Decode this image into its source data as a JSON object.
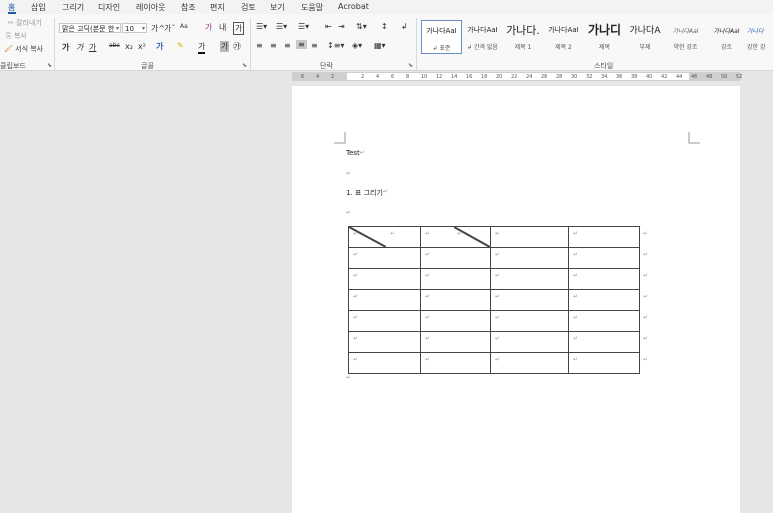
{
  "menu": [
    "홈",
    "삽입",
    "그리기",
    "디자인",
    "레이아웃",
    "참조",
    "편지",
    "검토",
    "보기",
    "도움말",
    "Acrobat"
  ],
  "clipboard": {
    "cut": "잘라내기",
    "copy": "복사",
    "format_painter": "서식 복사",
    "label": "클립보드"
  },
  "font": {
    "name": "맑은 고딕(본문 한",
    "size": "10",
    "grow": "가^",
    "shrink": "가ˇ",
    "case": "Aa",
    "clear": "가",
    "phonetic": "내",
    "charborder": "가",
    "bold": "가",
    "italic": "가",
    "underline": "가",
    "strike": "abc",
    "subscript": "x₂",
    "superscript": "x²",
    "text_effect": "가",
    "highlight": "가",
    "font_color": "가",
    "shading": "가",
    "enclose": "㉮",
    "label": "글꼴"
  },
  "paragraph": {
    "label": "단락"
  },
  "styles": {
    "label": "스타일",
    "items": [
      {
        "sample": "가나다AaI",
        "name": "↲ 표준"
      },
      {
        "sample": "가나다AaI",
        "name": "↲ 간격 없음"
      },
      {
        "sample": "가나다.",
        "name": "제목 1"
      },
      {
        "sample": "가나다AaI",
        "name": "제목 2"
      },
      {
        "sample": "가나디",
        "name": "제목"
      },
      {
        "sample": "가나다A",
        "name": "부제"
      },
      {
        "sample": "가나다AaI",
        "name": "약한 강조"
      },
      {
        "sample": "가나다AaI",
        "name": "강조"
      },
      {
        "sample": "가나다",
        "name": "강한 강"
      }
    ]
  },
  "ruler": {
    "ticks": [
      "6",
      "4",
      "2",
      "",
      "2",
      "4",
      "6",
      "8",
      "10",
      "12",
      "14",
      "16",
      "18",
      "20",
      "22",
      "24",
      "26",
      "28",
      "30",
      "32",
      "34",
      "36",
      "38",
      "40",
      "42",
      "44",
      "46",
      "48",
      "50",
      "52"
    ]
  },
  "document": {
    "line1": "Test",
    "list_item": "1.  표 그리기",
    "para_mark": "↵",
    "table": {
      "rows": 7,
      "cols": 4,
      "diagonal_cells": [
        "r0c0",
        "r0c1b"
      ]
    }
  }
}
